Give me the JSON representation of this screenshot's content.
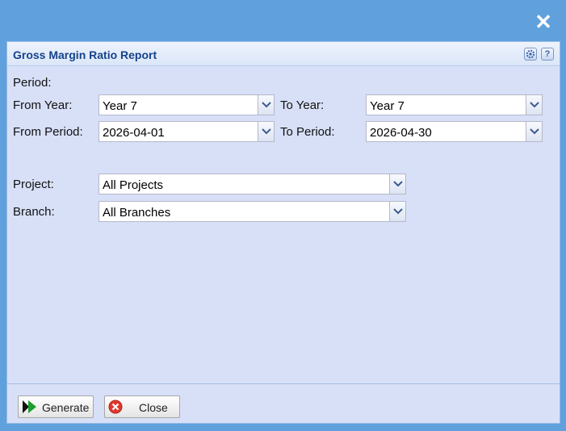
{
  "window": {
    "close_glyph": "✕"
  },
  "panel": {
    "title": "Gross Margin Ratio Report",
    "tools": {
      "gear": "gear-icon",
      "help": "?"
    }
  },
  "form": {
    "period_label": "Period:",
    "from_year": {
      "label": "From Year:",
      "value": "Year 7"
    },
    "to_year": {
      "label": "To Year:",
      "value": "Year 7"
    },
    "from_period": {
      "label": "From Period:",
      "value": "2026-04-01"
    },
    "to_period": {
      "label": "To Period:",
      "value": "2026-04-30"
    },
    "project": {
      "label": "Project:",
      "value": "All Projects"
    },
    "branch": {
      "label": "Branch:",
      "value": "All Branches"
    }
  },
  "footer": {
    "generate_label": "Generate",
    "close_label": "Close"
  },
  "colors": {
    "background": "#5fa0dd",
    "panel": "#d8e0f8",
    "title": "#15428b",
    "generate_icon": "#1a9e2c",
    "close_icon": "#e0382e"
  }
}
